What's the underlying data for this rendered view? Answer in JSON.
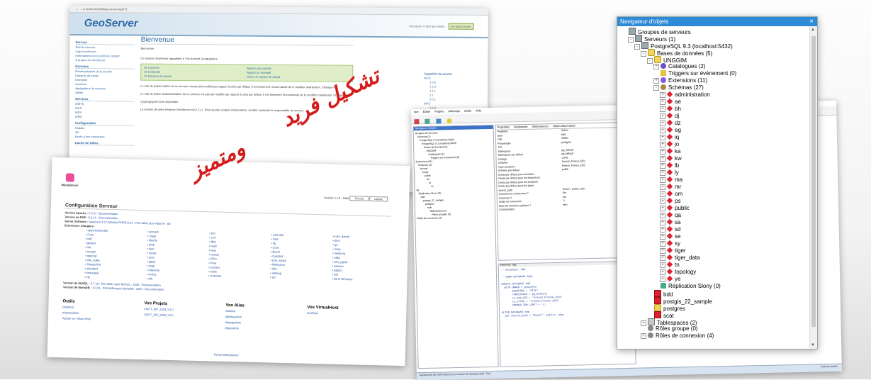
{
  "geoserver": {
    "url": "localhost:8080/geoserver/web/?1",
    "logo": "GeoServer",
    "header_user": "Connecté en tant que admin.",
    "header_logout": "Se déconnecter",
    "welcome_title": "Bienvenue",
    "welcome_sub": "Bienvenue",
    "side_sections": [
      {
        "title": "Serveur",
        "items": [
          "État du Serveur",
          "Logs GeoServer",
          "Informations sur le point de contact",
          "À propos de GeoServer"
        ]
      },
      {
        "title": "Données",
        "items": [
          "Prévisualisation de la couche",
          "Espaces de travail",
          "Entrepôts",
          "Couches",
          "Agrégations de couches",
          "Styles"
        ]
      },
      {
        "title": "Services",
        "items": [
          "WMTS",
          "WCS",
          "WFS",
          "WMS"
        ]
      },
      {
        "title": "Configuration",
        "items": [
          "Globale",
          "JAI",
          "Accès à une couverture"
        ]
      },
      {
        "title": "Cache de tuiles",
        "items": []
      }
    ],
    "service_text": "Ce service GeoServer appartient à The Ancient Geographers.",
    "actions": [
      "56 Couches",
      "Ajouter une couche",
      "22 Entrepôts",
      "Ajouter un entrepôt",
      "10 Espaces de travail",
      "Créer un espace de travail"
    ],
    "warnings": [
      "Le mot de passe maître de ce serveur n'a pas été modifié par rapport à celui par défaut. Il est fortement recommandé de le modifier maintenant. Changez-le",
      "Le mot de passe d'administration de ce serveur n'a pas été modifié par rapport à celui par défaut. Il est fortement recommandé de le modifier maintenant. Changez-le",
      "Cryptographie forte disponible",
      "La version de cette instance GeoServer est 2.11.1. Pour de plus amples informations, veuillez contacter le responsable du service."
    ],
    "caps_title": "Capacités du service",
    "caps": [
      "WCS",
      "1.0.0",
      "1.1.0",
      "1.1.1",
      "1.1",
      "2.0.1",
      "WFS",
      "1.0.0",
      "1.1.0"
    ]
  },
  "wamp": {
    "logo": "WampServer",
    "version_label": "Version 3.1.0 - 64bit",
    "lang_select": "French",
    "theme_select": "classic",
    "config_title": "Configuration Serveur",
    "config_rows": [
      {
        "k": "Version Apache :",
        "v": "2.4.27 - Documentation"
      },
      {
        "k": "Version de PHP :",
        "v": "5.6.31 - Documentation"
      },
      {
        "k": "Server Software :",
        "v": "Apache/2.4.27 (Win64) PHP/5.6.31 - Port défini pour Apache : 80"
      },
      {
        "k": "Extensions Chargées :",
        "v": ""
      }
    ],
    "extensions": [
      "apache2handler",
      "bcmath",
      "bz2",
      "calendar",
      "com_dotnet",
      "Core",
      "ctype",
      "curl",
      "date",
      "dom",
      "exif",
      "fileinfo",
      "filter",
      "ftp",
      "gd",
      "gettext",
      "gmp",
      "hash",
      "iconv",
      "imap",
      "intl",
      "json",
      "ldap",
      "libxml",
      "mbstring",
      "mcrypt",
      "mysql",
      "mysqli",
      "mysqlnd",
      "odbc",
      "openssl",
      "pcre",
      "PDO",
      "pdo_mysql",
      "pdo_pgsql",
      "pdo_sqlite",
      "pgsql",
      "Phar",
      "Reflection",
      "session",
      "SimpleXML",
      "soap",
      "sockets",
      "SPL",
      "sqlite3",
      "standard",
      "tokenizer",
      "wddx",
      "xdebug",
      "xml",
      "xmlreader",
      "xmlrpc",
      "xmlwriter",
      "xsl",
      "Zend OPcache",
      "zip",
      "zlib"
    ],
    "mysql_row": {
      "k": "Version de MySQL :",
      "v": "5.7.19 - Port défini pour MySQL : 3306 - Documentation"
    },
    "mariadb_row": {
      "k": "Version de MariaDB :",
      "v": "10.2.8 - Port défini pour MariaDB : 3307 - Documentation"
    },
    "tools_title": "Outils",
    "tools": [
      "phpinfo()",
      "phpmyadmin",
      "Ajouter un Virtual Host"
    ],
    "projects_title": "Vos Projets",
    "projects": [
      "CNCT_SIP_2018_V1.0",
      "CNCT_SIP_2018_V2.0"
    ],
    "alias_title": "Vos Alias",
    "alias": [
      "adminer",
      "phpmyadmin",
      "phppgadmin",
      "phpsysinfo"
    ],
    "vhost_title": "Vos VirtualHost",
    "vhosts": [
      "localhost"
    ],
    "footer": "Forum Wampserver"
  },
  "pgadmin": {
    "menu": [
      "hier",
      "Éditer",
      "Plugins",
      "Affichage",
      "Outils",
      "Aide"
    ],
    "tree_title": "Navigateur d'objets",
    "tree_items": [
      "Groupes de serveurs",
      "Serveurs (2)",
      "PostgreSQL 9.3 (localhost:5432)",
      "PostgreSQL 9.1 (localhost:5433)",
      "Bases de données (3)",
      "UNGGIM",
      "Catalogues (2)",
      "Triggers sur événement (0)",
      "Extensions (11)",
      "Schémas (3)",
      "brumai",
      "bmap",
      "public",
      "bh",
      "dj",
      "dz",
      "eg",
      "Réplication Slony (0)",
      "bdd",
      "postgis_21_sample",
      "postgres",
      "scat",
      "Tablespaces (2)",
      "Rôles groupes (0)",
      "Rôles de connexion (3)"
    ],
    "tabs": [
      "Propriétés",
      "Statistiques",
      "Dépendances",
      "Objets dépendants"
    ],
    "props": [
      [
        "Propriété",
        "Valeur"
      ],
      [
        "Nom",
        "bdd"
      ],
      [
        "OID",
        "32581"
      ],
      [
        "Propriétaire",
        "postgres"
      ],
      [
        "ACL",
        ""
      ],
      [
        "Tablespace",
        "pg_default"
      ],
      [
        "Tablespace par défaut",
        "pg_default"
      ],
      [
        "Codage",
        "UTF8"
      ],
      [
        "Collation",
        "French_France.1252"
      ],
      [
        "Type caractère",
        "French_France.1252"
      ],
      [
        "Schéma par défaut",
        "public"
      ],
      [
        "Droits par défaut pour les tables",
        ""
      ],
      [
        "Droits par défaut pour les séquences",
        ""
      ],
      [
        "Droits par défaut pour les fonctions",
        ""
      ],
      [
        "Droits par défaut pour les types",
        ""
      ],
      [
        "search_path",
        "\"$user\", public, adm"
      ],
      [
        "Autoriser les connexions ?",
        "Oui"
      ],
      [
        "Connecté ?",
        "Oui"
      ],
      [
        "Limite de connexion",
        "-1"
      ],
      [
        "Base de données système ?",
        "Non"
      ],
      [
        "Commentaire",
        ""
      ]
    ],
    "sql_title": "Panneau SQL",
    "sql_lines": [
      "-- Database: bdd",
      "",
      "-- DROP DATABASE bdd;",
      "",
      "CREATE DATABASE bdd",
      "  WITH OWNER = postgres",
      "       ENCODING = 'UTF8'",
      "       TABLESPACE = pg_default",
      "       LC_COLLATE = 'French_France.1252'",
      "       LC_CTYPE = 'French_France.1252'",
      "       CONNECTION LIMIT = -1;",
      "",
      "ALTER DATABASE bdd",
      "  SET search_path = \"$user\", public, adm;"
    ],
    "status_left": "Ajustement des informations sur la base de données bdd - Fait.",
    "status_right": "0,00 secondes"
  },
  "navigator": {
    "title": "Navigateur d'objets",
    "close_icon": "×",
    "nodes": [
      {
        "label": "Groupes de serveurs",
        "depth": 0,
        "ex": "",
        "icon": "srv"
      },
      {
        "label": "Serveurs (1)",
        "depth": 1,
        "ex": "-",
        "icon": "srv"
      },
      {
        "label": "PostgreSQL 9.3 (localhost:5432)",
        "depth": 2,
        "ex": "-",
        "icon": "srv"
      },
      {
        "label": "Bases de données (5)",
        "depth": 3,
        "ex": "-",
        "icon": "db"
      },
      {
        "label": "UNGGIM",
        "depth": 4,
        "ex": "-",
        "icon": "db"
      },
      {
        "label": "Catalogues (2)",
        "depth": 5,
        "ex": "+",
        "icon": "cat"
      },
      {
        "label": "Triggers sur événement (0)",
        "depth": 5,
        "ex": "",
        "icon": "trig"
      },
      {
        "label": "Extensions (11)",
        "depth": 5,
        "ex": "+",
        "icon": "ext"
      },
      {
        "label": "Schémas (27)",
        "depth": 5,
        "ex": "-",
        "icon": "sch"
      },
      {
        "label": "administration",
        "depth": 6,
        "ex": "+",
        "icon": "diam"
      },
      {
        "label": "ae",
        "depth": 6,
        "ex": "+",
        "icon": "diam"
      },
      {
        "label": "bh",
        "depth": 6,
        "ex": "+",
        "icon": "diam"
      },
      {
        "label": "dj",
        "depth": 6,
        "ex": "+",
        "icon": "diam"
      },
      {
        "label": "dz",
        "depth": 6,
        "ex": "+",
        "icon": "diam"
      },
      {
        "label": "eg",
        "depth": 6,
        "ex": "+",
        "icon": "diam"
      },
      {
        "label": "iq",
        "depth": 6,
        "ex": "+",
        "icon": "diam"
      },
      {
        "label": "jo",
        "depth": 6,
        "ex": "+",
        "icon": "diam"
      },
      {
        "label": "ka",
        "depth": 6,
        "ex": "+",
        "icon": "diam"
      },
      {
        "label": "kw",
        "depth": 6,
        "ex": "+",
        "icon": "diam"
      },
      {
        "label": "lb",
        "depth": 6,
        "ex": "+",
        "icon": "diam"
      },
      {
        "label": "ly",
        "depth": 6,
        "ex": "+",
        "icon": "diam"
      },
      {
        "label": "ma",
        "depth": 6,
        "ex": "+",
        "icon": "diam"
      },
      {
        "label": "mr",
        "depth": 6,
        "ex": "+",
        "icon": "diam"
      },
      {
        "label": "om",
        "depth": 6,
        "ex": "+",
        "icon": "diam"
      },
      {
        "label": "ps",
        "depth": 6,
        "ex": "+",
        "icon": "diam"
      },
      {
        "label": "public",
        "depth": 6,
        "ex": "+",
        "icon": "diam"
      },
      {
        "label": "qa",
        "depth": 6,
        "ex": "+",
        "icon": "diam"
      },
      {
        "label": "sa",
        "depth": 6,
        "ex": "+",
        "icon": "diam"
      },
      {
        "label": "sd",
        "depth": 6,
        "ex": "+",
        "icon": "diam"
      },
      {
        "label": "se",
        "depth": 6,
        "ex": "+",
        "icon": "diam"
      },
      {
        "label": "sy",
        "depth": 6,
        "ex": "+",
        "icon": "diam"
      },
      {
        "label": "tiger",
        "depth": 6,
        "ex": "+",
        "icon": "diam"
      },
      {
        "label": "tiger_data",
        "depth": 6,
        "ex": "+",
        "icon": "diam"
      },
      {
        "label": "tn",
        "depth": 6,
        "ex": "+",
        "icon": "diam"
      },
      {
        "label": "topology",
        "depth": 6,
        "ex": "+",
        "icon": "diam"
      },
      {
        "label": "ye",
        "depth": 6,
        "ex": "+",
        "icon": "diam"
      },
      {
        "label": "Réplication Slony (0)",
        "depth": 5,
        "ex": "",
        "icon": "slony"
      },
      {
        "label": "bdd",
        "depth": 4,
        "ex": "",
        "icon": "red"
      },
      {
        "label": "postgis_22_sample",
        "depth": 4,
        "ex": "",
        "icon": "red"
      },
      {
        "label": "postgres",
        "depth": 4,
        "ex": "",
        "icon": "db"
      },
      {
        "label": "scat",
        "depth": 4,
        "ex": "",
        "icon": "red"
      },
      {
        "label": "Tablespaces (2)",
        "depth": 3,
        "ex": "+",
        "icon": "ts"
      },
      {
        "label": "Rôles groupe (0)",
        "depth": 3,
        "ex": "",
        "icon": "role"
      },
      {
        "label": "Rôles de connexion (4)",
        "depth": 3,
        "ex": "+",
        "icon": "role"
      }
    ]
  },
  "overlay": {
    "arabic_line1": "تشكيل فريد",
    "arabic_line2": "ومتميز"
  }
}
